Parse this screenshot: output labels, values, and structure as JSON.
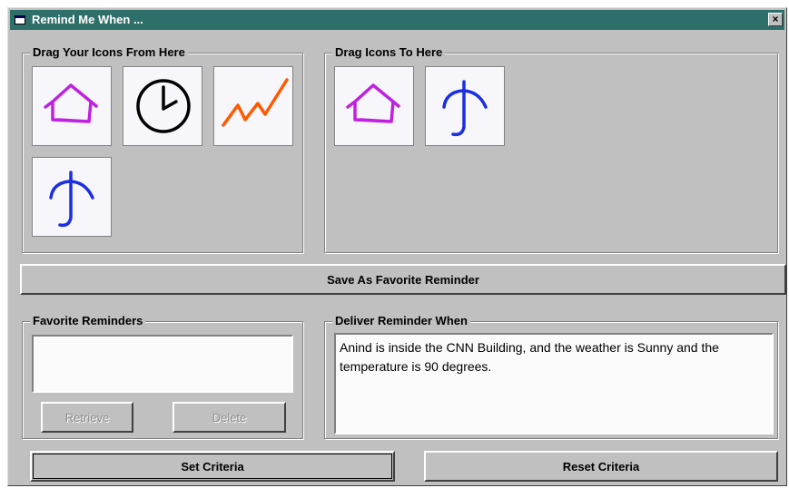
{
  "window": {
    "title": "Remind Me When ...",
    "close_label": "×"
  },
  "source_panel": {
    "label": "Drag Your Icons From Here",
    "icons": [
      "house-icon",
      "clock-icon",
      "trend-icon",
      "umbrella-icon"
    ]
  },
  "target_panel": {
    "label": "Drag Icons To Here",
    "icons": [
      "house-icon",
      "umbrella-icon"
    ]
  },
  "save_button": {
    "label": "Save As Favorite Reminder"
  },
  "favorites": {
    "label": "Favorite Reminders",
    "items": [],
    "retrieve_label": "Retrieve",
    "delete_label": "Delete"
  },
  "deliver": {
    "label": "Deliver Reminder When",
    "text": "Anind is inside the CNN Building, and the weather is Sunny and the temperature is 90 degrees."
  },
  "buttons": {
    "set_criteria": "Set Criteria",
    "reset_criteria": "Reset Criteria"
  },
  "colors": {
    "title_bar": "#2f6f6a",
    "house": "#c020e0",
    "clock": "#000000",
    "trend": "#ff5a00",
    "umbrella": "#1c2fe0"
  }
}
